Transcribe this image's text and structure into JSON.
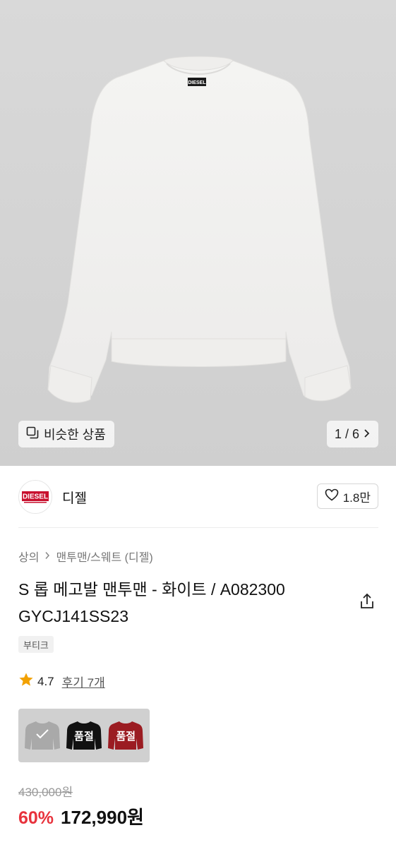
{
  "hero": {
    "similar_label": "비슷한 상품",
    "counter": "1 / 6",
    "image_brand_label": "DIESEL"
  },
  "brand": {
    "logo_text": "DIESEL",
    "name": "디젤",
    "like_count": "1.8만"
  },
  "breadcrumb": {
    "items": [
      "상의",
      "맨투맨/스웨트 (디젤)"
    ]
  },
  "product": {
    "title": "S 롭 메고발 맨투맨 - 화이트 / A082300 GYCJ141SS23",
    "tag": "부티크",
    "rating": "4.7",
    "review_label": "후기 7개"
  },
  "options": [
    {
      "color": "#a9a9a9",
      "state": "selected"
    },
    {
      "color": "#111111",
      "state": "sold_out",
      "label": "품절"
    },
    {
      "color": "#9b1c22",
      "state": "sold_out",
      "label": "품절"
    }
  ],
  "price": {
    "original": "430,000원",
    "discount": "60%",
    "sale": "172,990원"
  },
  "colors": {
    "discount": "#e8323c",
    "brand_red": "#c8102e",
    "star": "#f2a100"
  }
}
